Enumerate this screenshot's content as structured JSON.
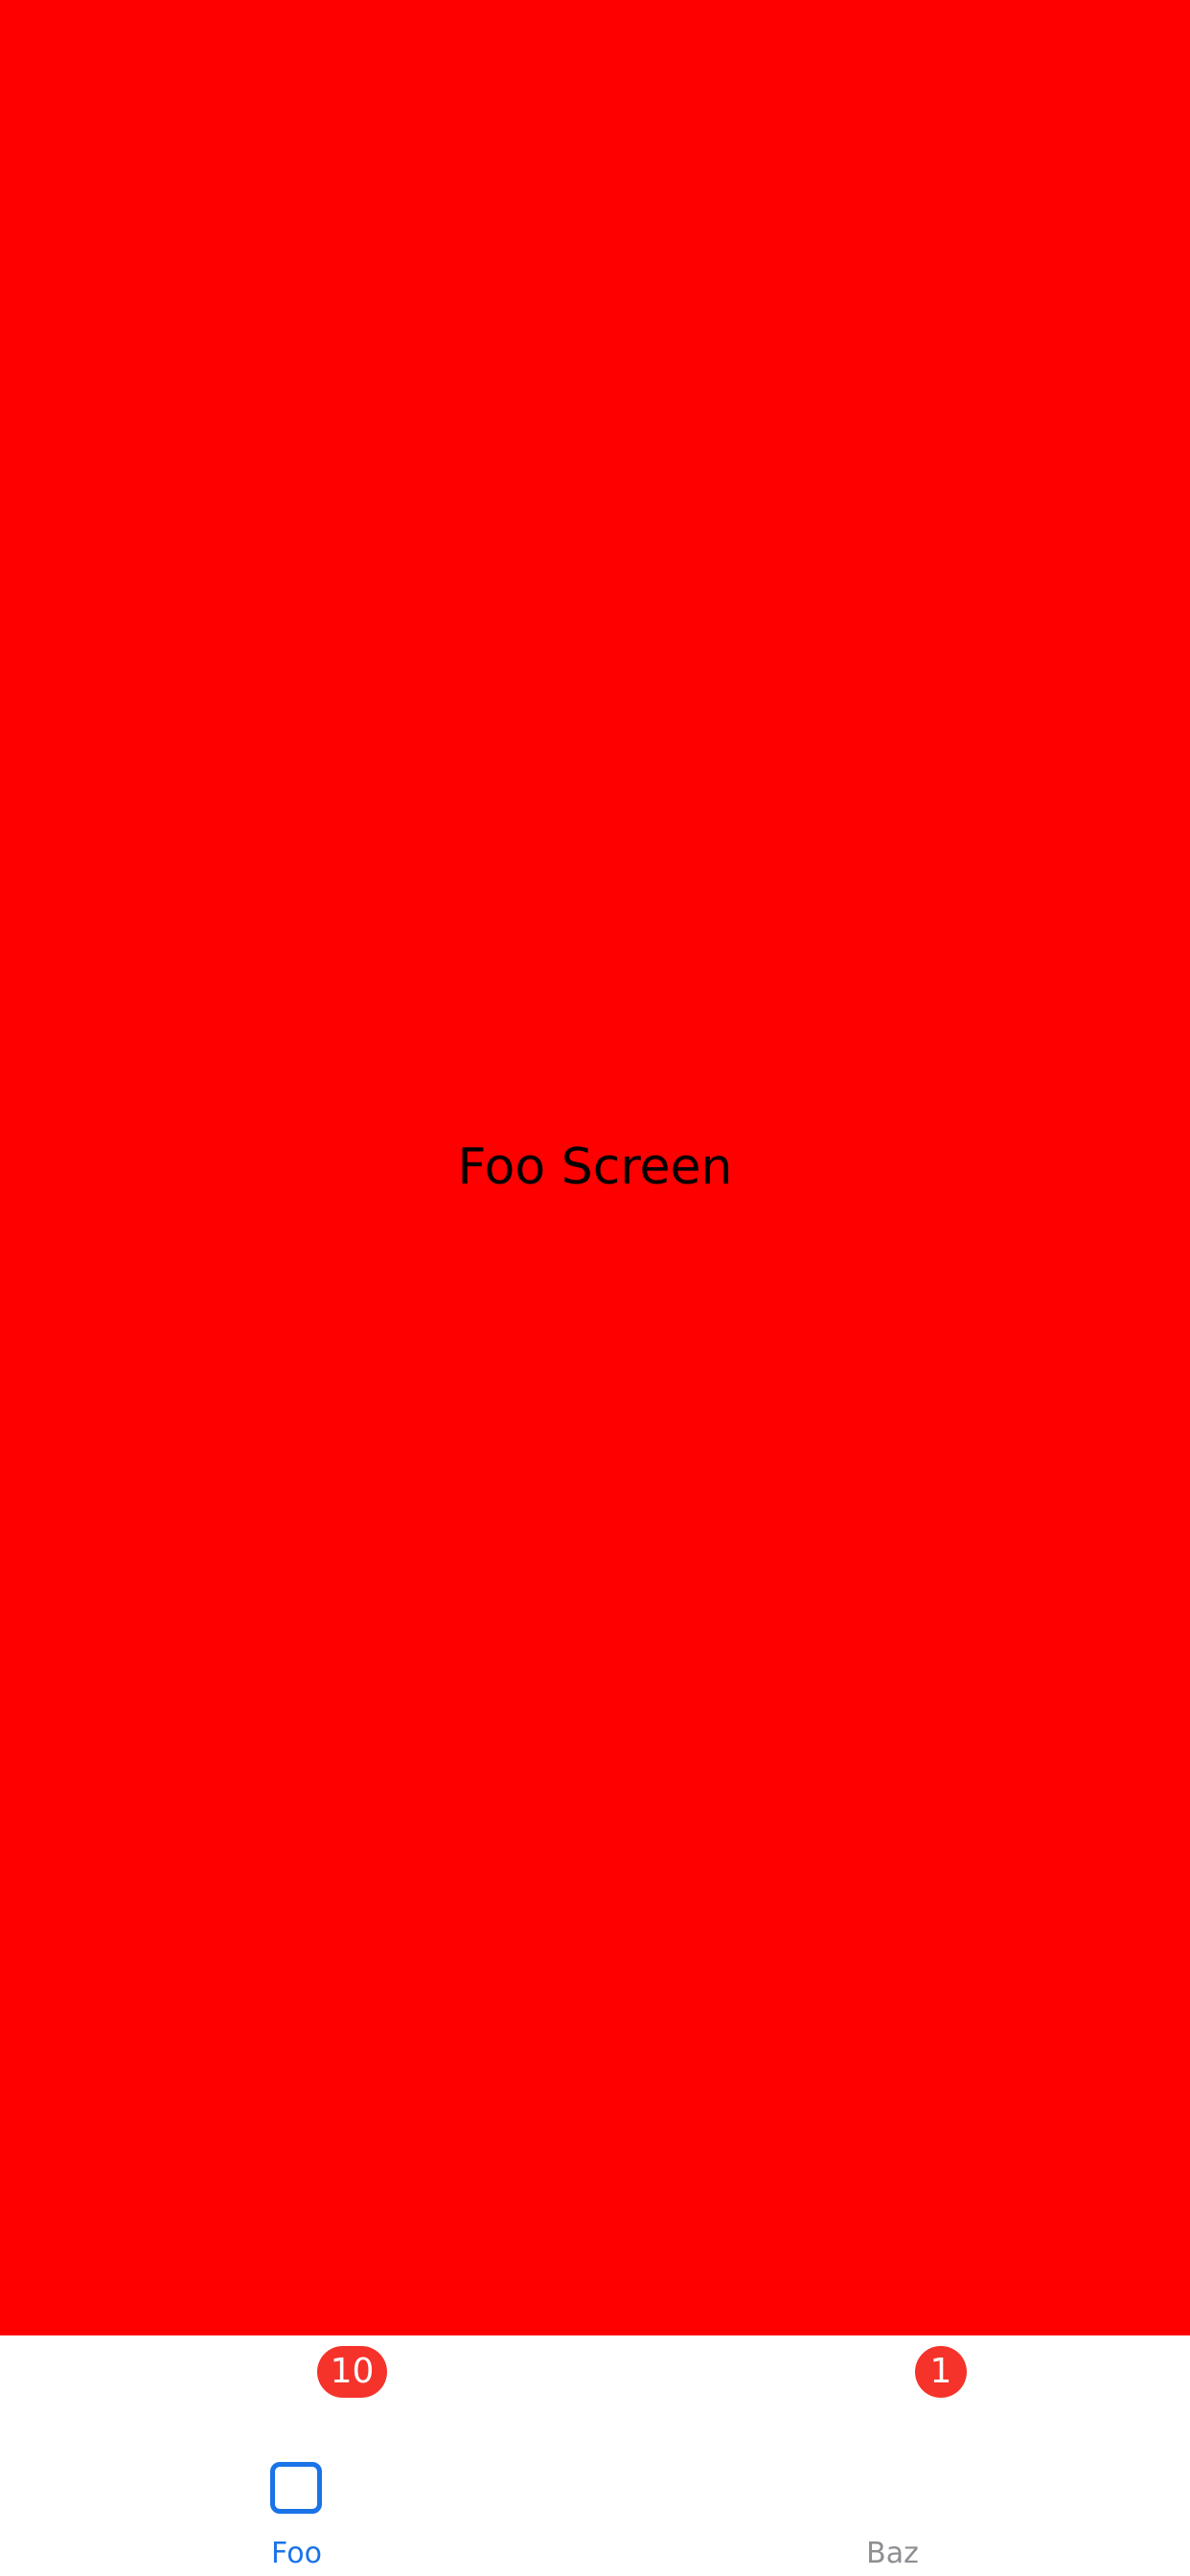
{
  "screen": {
    "title": "Foo Screen",
    "background": "#ff0000"
  },
  "tabbar": {
    "active_color": "#1a73e8",
    "inactive_color": "#8e8e93",
    "badge_color": "#f5332a",
    "tabs": [
      {
        "label": "Foo",
        "badge": "10",
        "icon": "square-icon",
        "active": true
      },
      {
        "label": "Baz",
        "badge": "1",
        "icon": "",
        "active": false
      }
    ]
  }
}
